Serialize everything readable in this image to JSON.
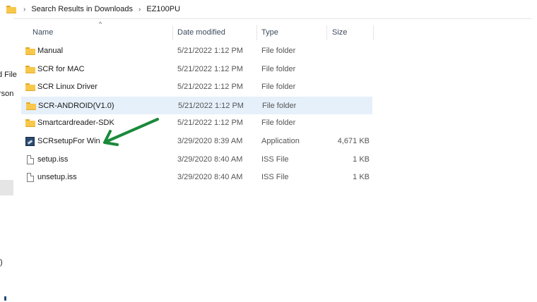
{
  "address_bar": {
    "crumbs": [
      "Search Results in Downloads",
      "EZ100PU"
    ]
  },
  "nav_fragments": [
    "d File",
    "rson",
    ":)"
  ],
  "columns": {
    "name": "Name",
    "date": "Date modified",
    "type": "Type",
    "size": "Size"
  },
  "files": [
    {
      "name": "Manual",
      "date": "5/21/2022 1:12 PM",
      "type": "File folder",
      "size": "",
      "icon": "folder-icon"
    },
    {
      "name": "SCR for MAC",
      "date": "5/21/2022 1:12 PM",
      "type": "File folder",
      "size": "",
      "icon": "folder-icon"
    },
    {
      "name": "SCR Linux Driver",
      "date": "5/21/2022 1:12 PM",
      "type": "File folder",
      "size": "",
      "icon": "folder-icon"
    },
    {
      "name": "SCR-ANDROID(V1.0)",
      "date": "5/21/2022 1:12 PM",
      "type": "File folder",
      "size": "",
      "icon": "folder-icon",
      "selected": true
    },
    {
      "name": "Smartcardreader-SDK",
      "date": "5/21/2022 1:12 PM",
      "type": "File folder",
      "size": "",
      "icon": "folder-icon"
    },
    {
      "name": "SCRsetupFor Win",
      "date": "3/29/2020 8:39 AM",
      "type": "Application",
      "size": "4,671 KB",
      "icon": "application-icon"
    },
    {
      "name": "setup.iss",
      "date": "3/29/2020 8:40 AM",
      "type": "ISS File",
      "size": "1 KB",
      "icon": "file-icon"
    },
    {
      "name": "unsetup.iss",
      "date": "3/29/2020 8:40 AM",
      "type": "ISS File",
      "size": "1 KB",
      "icon": "file-icon"
    }
  ],
  "colors": {
    "selected_row": "#e6f0fa",
    "folder": "#f8c84a",
    "arrow": "#1a8a3a"
  }
}
